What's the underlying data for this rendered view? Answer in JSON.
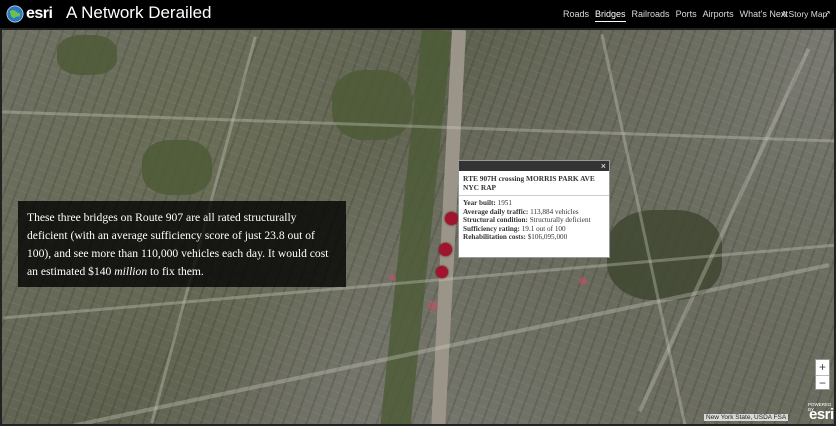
{
  "header": {
    "logo_text": "esri",
    "title": "A Network Derailed",
    "nav": [
      "Roads",
      "Bridges",
      "Railroads",
      "Ports",
      "Airports",
      "What's Next"
    ],
    "active_nav": "Bridges",
    "story_map_label": "A Story Map",
    "story_map_icon": "external-link-icon"
  },
  "story": {
    "text_before": "These three bridges on Route 907 are all rated structurally deficient (with an average sufficiency score of just 23.8 out of 100), and see more than 110,000 vehicles each day. It would cost an estimated $140 ",
    "text_emph": "million",
    "text_after": " to fix them."
  },
  "popup": {
    "close_icon": "×",
    "title": "RTE 907H crossing MORRIS PARK AVE NYC RAP",
    "fields": [
      {
        "label": "Year built:",
        "value": "1951"
      },
      {
        "label": "Average daily traffic:",
        "value": "113,884 vehicles"
      },
      {
        "label": "Structural condition:",
        "value": "Structurally deficient"
      },
      {
        "label": "Sufficiency rating:",
        "value": "19.1 out of 100"
      },
      {
        "label": "Rehabilitation costs:",
        "value": "$106,095,000"
      }
    ]
  },
  "zoom": {
    "in": "+",
    "out": "−"
  },
  "attribution": "New York State, USDA FSA",
  "powered_by": "POWERED BY",
  "powered_logo": "esri",
  "colors": {
    "header_bg": "#000000",
    "marker": "#a0142d",
    "panel_bg": "rgba(0,0,0,0.78)"
  }
}
